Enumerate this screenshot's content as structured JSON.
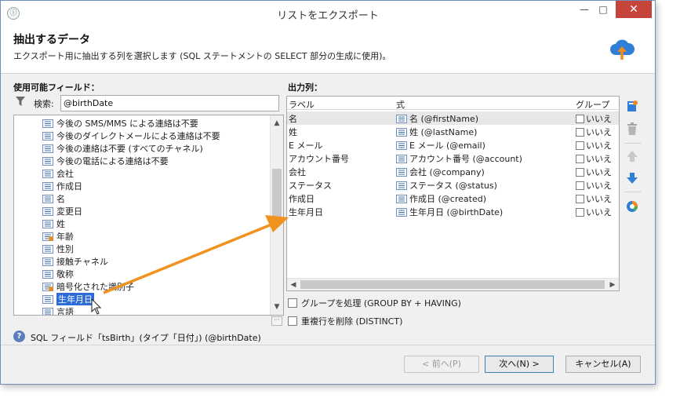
{
  "window": {
    "app_icon": "ⓘ",
    "title": "リストをエクスポート",
    "minimize": "—",
    "maximize": "□",
    "close": "✕"
  },
  "header": {
    "title": "抽出するデータ",
    "description": "エクスポート用に抽出する列を選択します (SQL ステートメントの SELECT 部分の生成に使用)。",
    "icon": "cloud-upload-icon"
  },
  "available_fields": {
    "label": "使用可能フィールド：",
    "search_label": "検索:",
    "search_value": "@birthDate",
    "items": [
      {
        "label": "今後の SMS/MMS による連絡は不要",
        "icon": "field-icon"
      },
      {
        "label": "今後のダイレクトメールによる連絡は不要",
        "icon": "field-icon"
      },
      {
        "label": "今後の連絡は不要 (すべてのチャネル)",
        "icon": "field-icon"
      },
      {
        "label": "今後の電話による連絡は不要",
        "icon": "field-icon"
      },
      {
        "label": "会社",
        "icon": "field-icon"
      },
      {
        "label": "作成日",
        "icon": "field-icon"
      },
      {
        "label": "名",
        "icon": "field-icon"
      },
      {
        "label": "変更日",
        "icon": "field-icon"
      },
      {
        "label": "姓",
        "icon": "field-icon"
      },
      {
        "label": "年齢",
        "icon": "computed-field-icon"
      },
      {
        "label": "性別",
        "icon": "field-icon"
      },
      {
        "label": "接触チャネル",
        "icon": "field-icon"
      },
      {
        "label": "敬称",
        "icon": "field-icon"
      },
      {
        "label": "暗号化された識別子",
        "icon": "computed-field-icon"
      },
      {
        "label": "生年月日",
        "icon": "field-icon",
        "selected": true
      },
      {
        "label": "言語",
        "icon": "field-icon"
      }
    ],
    "more_button": "···"
  },
  "hint": {
    "icon": "?",
    "text": "SQL フィールド「tsBirth」(タイプ「日付」) (@birthDate)"
  },
  "output_columns": {
    "label": "出力列：",
    "headers": {
      "label": "ラベル",
      "expression": "式",
      "group": "グループ"
    },
    "rows": [
      {
        "label": "名",
        "expression": "名 (@firstName)",
        "group": "いいえ"
      },
      {
        "label": "姓",
        "expression": "姓 (@lastName)",
        "group": "いいえ"
      },
      {
        "label": "E メール",
        "expression": "E メール (@email)",
        "group": "いいえ"
      },
      {
        "label": "アカウント番号",
        "expression": "アカウント番号 (@account)",
        "group": "いいえ"
      },
      {
        "label": "会社",
        "expression": "会社 (@company)",
        "group": "いいえ"
      },
      {
        "label": "ステータス",
        "expression": "ステータス (@status)",
        "group": "いいえ"
      },
      {
        "label": "作成日",
        "expression": "作成日 (@created)",
        "group": "いいえ"
      },
      {
        "label": "生年月日",
        "expression": "生年月日 (@birthDate)",
        "group": "いいえ"
      }
    ]
  },
  "side_toolbar": [
    "add-column-icon",
    "trash-icon",
    "move-up-icon",
    "move-down-icon",
    "distribution-icon"
  ],
  "options": {
    "group_by": "グループを処理 (GROUP BY + HAVING)",
    "distinct": "重複行を削除 (DISTINCT)"
  },
  "buttons": {
    "back": "< 前へ(P)",
    "next": "次へ(N) >",
    "cancel": "キャンセル(A)"
  },
  "colors": {
    "selection": "#2d6cd6",
    "annotation_arrow": "#f0921e",
    "close_button": "#c7443a",
    "add_icon": "#2f7fd6"
  }
}
